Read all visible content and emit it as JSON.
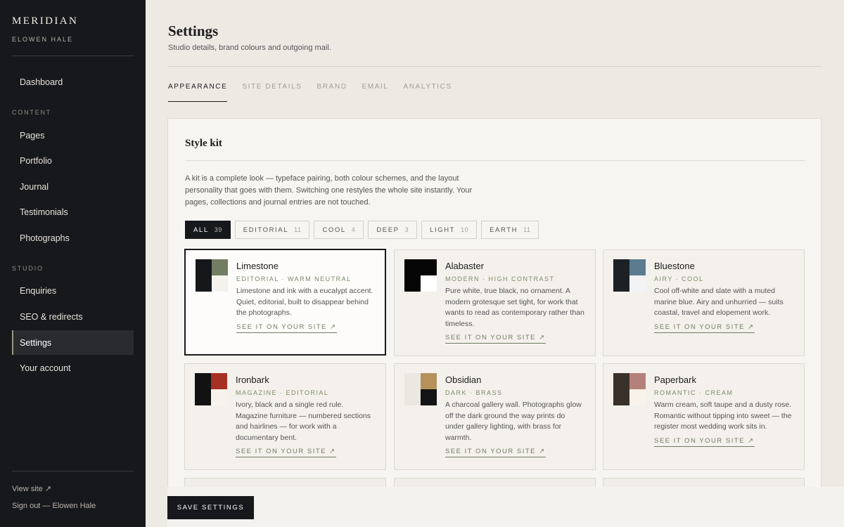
{
  "sidebar": {
    "brand": "MERIDIAN",
    "user": "ELOWEN HALE",
    "dashboard": "Dashboard",
    "section_content": "CONTENT",
    "content_items": [
      "Pages",
      "Portfolio",
      "Journal",
      "Testimonials",
      "Photographs"
    ],
    "section_studio": "STUDIO",
    "studio_items": [
      "Enquiries",
      "SEO & redirects",
      "Settings",
      "Your account"
    ],
    "active_item": "Settings",
    "view_site": "View site ↗",
    "sign_out": "Sign out — Elowen Hale"
  },
  "header": {
    "title": "Settings",
    "subtitle": "Studio details, brand colours and outgoing mail."
  },
  "tabs": [
    "APPEARANCE",
    "SITE DETAILS",
    "BRAND",
    "EMAIL",
    "ANALYTICS"
  ],
  "active_tab": "APPEARANCE",
  "panel": {
    "title": "Style kit",
    "description": "A kit is a complete look — typeface pairing, both colour schemes, and the layout personality that goes with them. Switching one restyles the whole site instantly. Your pages, collections and journal entries are not touched."
  },
  "filters": [
    {
      "label": "ALL",
      "count": "39"
    },
    {
      "label": "EDITORIAL",
      "count": "11"
    },
    {
      "label": "COOL",
      "count": "4"
    },
    {
      "label": "DEEP",
      "count": "3"
    },
    {
      "label": "LIGHT",
      "count": "10"
    },
    {
      "label": "EARTH",
      "count": "11"
    }
  ],
  "active_filter": "ALL",
  "kits": [
    {
      "name": "Limestone",
      "tags": "EDITORIAL · WARM NEUTRAL",
      "desc": "Limestone and ink with a eucalypt accent. Quiet, editorial, built to disappear behind the photographs.",
      "link": "SEE IT ON YOUR SITE ↗",
      "colors": [
        "#15171b",
        "#727d62",
        "#f5f2ed"
      ]
    },
    {
      "name": "Alabaster",
      "tags": "MODERN · HIGH CONTRAST",
      "desc": "Pure white, true black, no ornament. A modern grotesque set tight, for work that wants to read as contemporary rather than timeless.",
      "link": "SEE IT ON YOUR SITE ↗",
      "colors": [
        "#050505",
        "#050505",
        "#ffffff"
      ]
    },
    {
      "name": "Bluestone",
      "tags": "AIRY · COOL",
      "desc": "Cool off-white and slate with a muted marine blue. Airy and unhurried — suits coastal, travel and elopement work.",
      "link": "SEE IT ON YOUR SITE ↗",
      "colors": [
        "#1c2126",
        "#5a7b90",
        "#f1f3f4"
      ]
    },
    {
      "name": "Ironbark",
      "tags": "MAGAZINE · EDITORIAL",
      "desc": "Ivory, black and a single red rule. Magazine furniture — numbered sections and hairlines — for work with a documentary bent.",
      "link": "SEE IT ON YOUR SITE ↗",
      "colors": [
        "#121212",
        "#a63024",
        "#f7f3ec"
      ]
    },
    {
      "name": "Obsidian",
      "tags": "DARK · BRASS",
      "desc": "A charcoal gallery wall. Photographs glow off the dark ground the way prints do under gallery lighting, with brass for warmth.",
      "link": "SEE IT ON YOUR SITE ↗",
      "colors": [
        "#ebe7e1",
        "#b5925c",
        "#131416"
      ]
    },
    {
      "name": "Paperbark",
      "tags": "ROMANTIC · CREAM",
      "desc": "Warm cream, soft taupe and a dusty rose. Romantic without tipping into sweet — the register most wedding work sits in.",
      "link": "SEE IT ON YOUR SITE ↗",
      "colors": [
        "#3a302a",
        "#b38179",
        "#f8f3ea"
      ]
    }
  ],
  "selected_kit": "Limestone",
  "save_label": "SAVE SETTINGS"
}
